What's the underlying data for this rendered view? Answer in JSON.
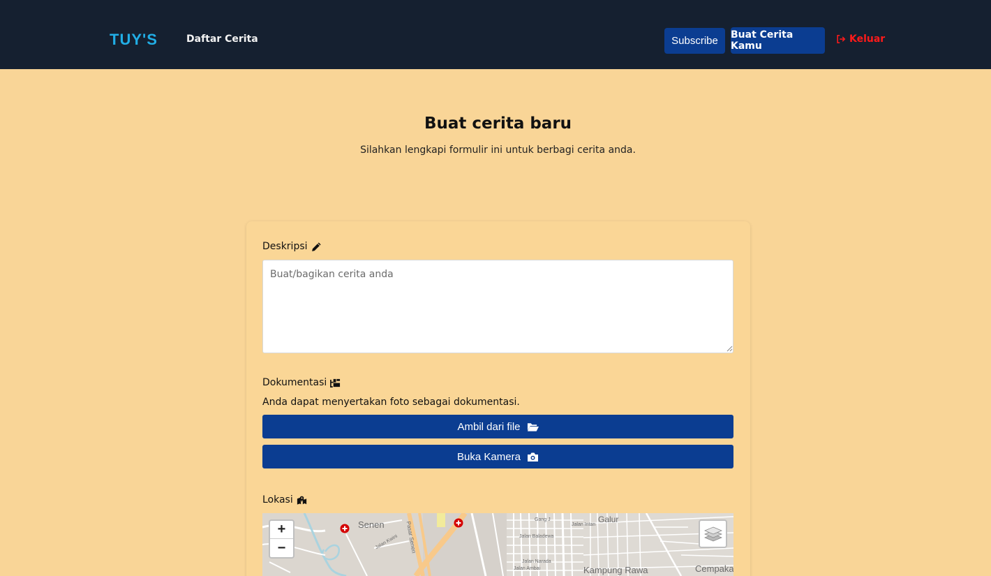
{
  "navbar": {
    "brand": "TUY'S",
    "link_stories": "Daftar Cerita",
    "subscribe": "Subscribe",
    "create_story": "Buat Cerita Kamu",
    "logout": "Keluar",
    "background": "#152030",
    "brand_color": "#21aee6",
    "logout_color": "#ff1a1a",
    "button_color": "#0b3d91"
  },
  "page": {
    "title": "Buat cerita baru",
    "subtitle": "Silahkan lengkapi formulir ini untuk berbagi cerita anda.",
    "background": "#f9d597"
  },
  "form": {
    "description_label": "Deskripsi",
    "description_icon": "pencil-icon",
    "description_placeholder": "Buat/bagikan cerita anda",
    "description_value": "",
    "documentation_label": "Dokumentasi",
    "documentation_icon": "images-icon",
    "documentation_help": "Anda dapat menyertakan foto sebagai dokumentasi.",
    "file_button": "Ambil dari file",
    "file_icon": "folder-open-icon",
    "camera_button": "Buka Kamera",
    "camera_icon": "camera-icon",
    "location_label": "Lokasi",
    "location_icon": "map-location-icon"
  },
  "map": {
    "zoom_in": "+",
    "zoom_out": "−",
    "layers_icon": "layers-icon",
    "labels": {
      "senen": "Senen",
      "galur": "Galur",
      "kampung_rawa": "Kampung Rawa",
      "cempaka": "Cempaka",
      "jalan_kwini": "Jalan Kwini",
      "pasar_senen": "Pasar Senen",
      "gang_j": "Gang J",
      "jalan_baladewa": "Jalan Baladewa",
      "jalan_narada": "Jalan Narada",
      "jalan_ambai": "Jalan Ambai",
      "jalan_intan": "Jalan Intan"
    }
  }
}
